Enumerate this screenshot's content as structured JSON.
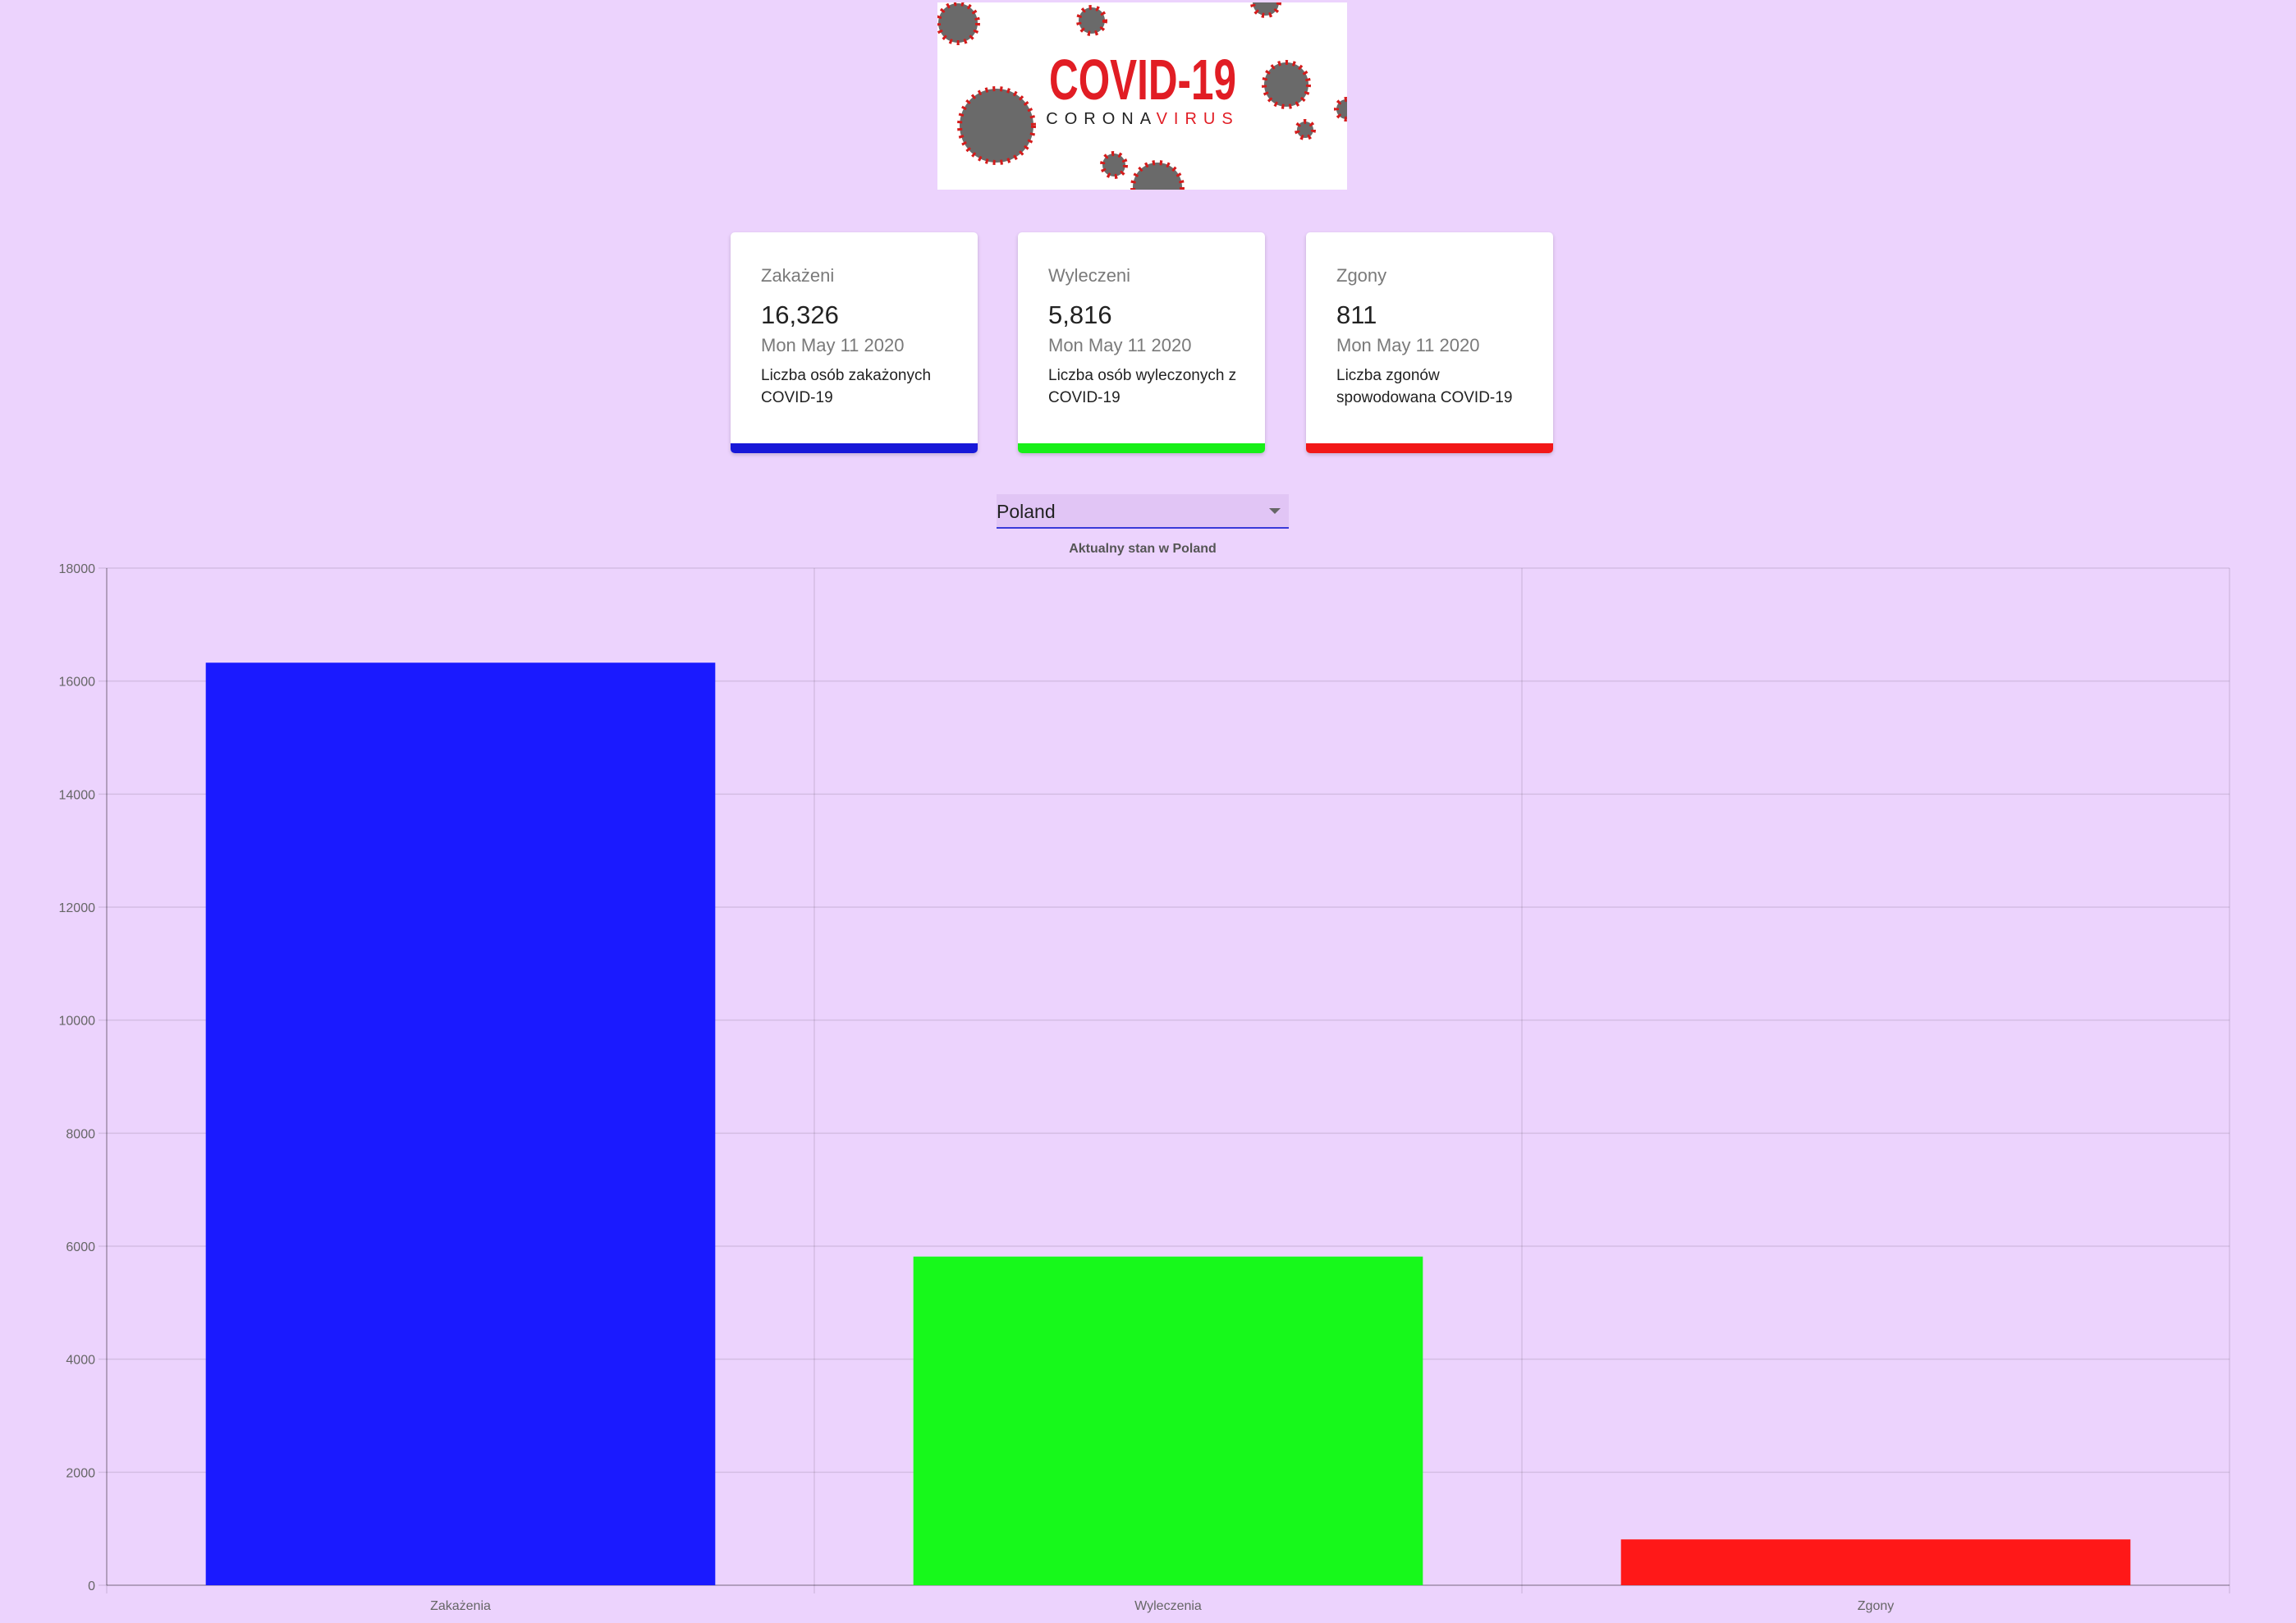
{
  "banner": {
    "title": "COVID-19",
    "subtitle_part1": "CORONA",
    "subtitle_part2": "VIRUS"
  },
  "cards": [
    {
      "title": "Zakażeni",
      "value": "16,326",
      "date": "Mon May 11 2020",
      "description": "Liczba osób zakażonych COVID-19",
      "color": "#1818d8"
    },
    {
      "title": "Wyleczeni",
      "value": "5,816",
      "date": "Mon May 11 2020",
      "description": "Liczba osób wyleczonych z COVID-19",
      "color": "#18ef18"
    },
    {
      "title": "Zgony",
      "value": "811",
      "date": "Mon May 11 2020",
      "description": "Liczba zgonów spowodowana COVID-19",
      "color": "#f21818"
    }
  ],
  "country_select": {
    "value": "Poland"
  },
  "chart_data": {
    "type": "bar",
    "title": "Aktualny stan w Poland",
    "categories": [
      "Zakażenia",
      "Wyleczenia",
      "Zgony"
    ],
    "values": [
      16326,
      5816,
      811
    ],
    "colors": [
      "#1a1aff",
      "#17f91b",
      "#ff1818"
    ],
    "ylim": [
      0,
      18000
    ],
    "yticks": [
      0,
      2000,
      4000,
      6000,
      8000,
      10000,
      12000,
      14000,
      16000,
      18000
    ],
    "grid": true,
    "legend": "none"
  }
}
